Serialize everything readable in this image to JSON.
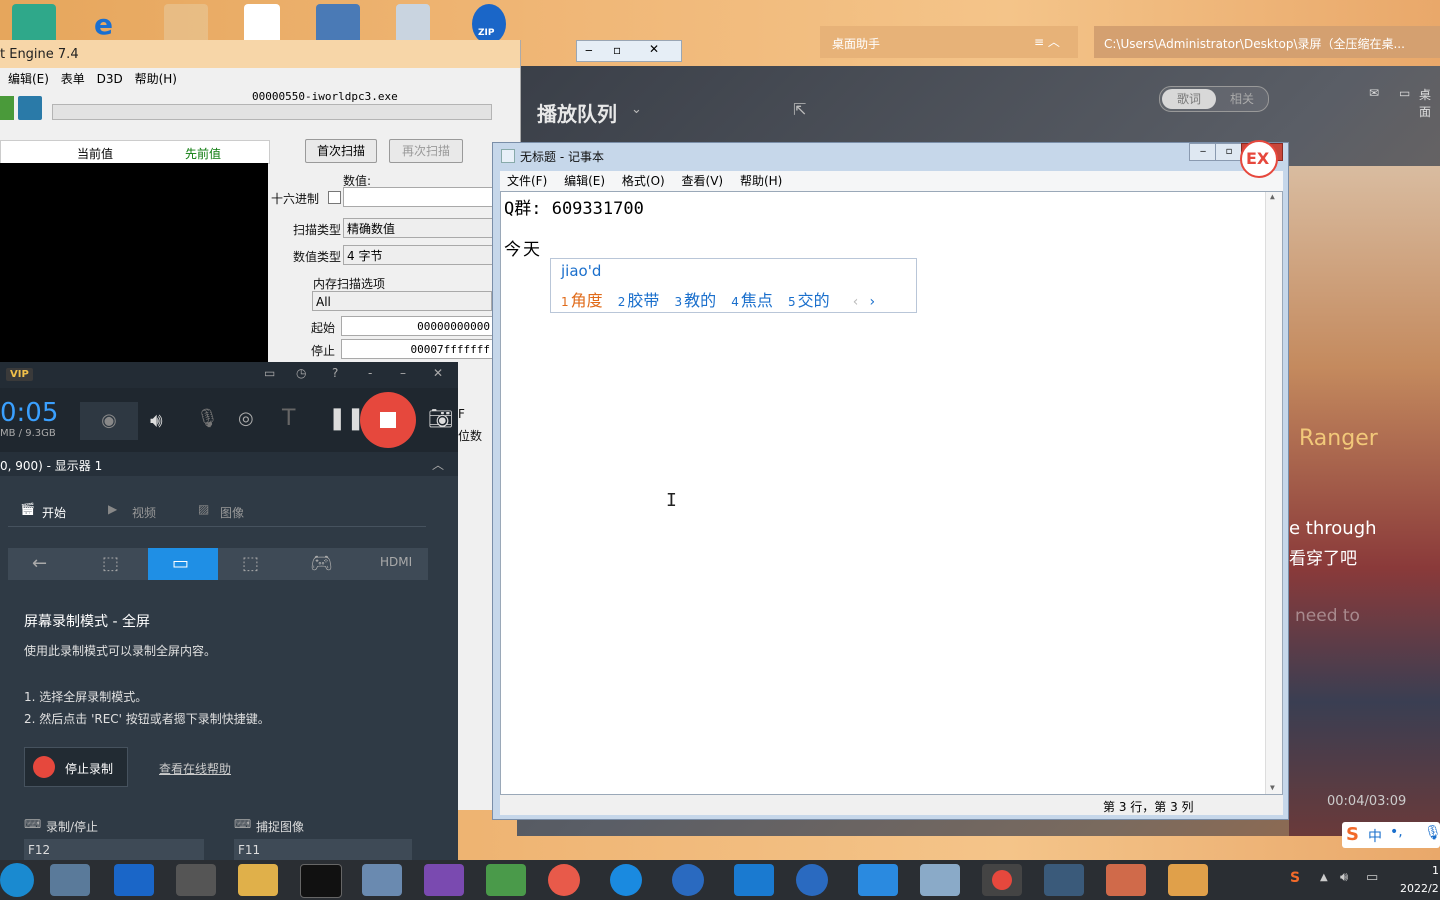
{
  "ce": {
    "title": "t Engine 7.4",
    "process": "00000550-iworldpc3.exe",
    "menu": [
      "编辑(E)",
      "表单",
      "D3D",
      "帮助(H)"
    ],
    "col_current": "当前值",
    "col_previous": "先前值",
    "first_scan": "首次扫描",
    "next_scan": "再次扫描",
    "value_label": "数值:",
    "hex_label": "十六进制",
    "scan_type_label": "扫描类型",
    "scan_type_value": "精确数值",
    "value_type_label": "数值类型",
    "value_type_value": "4 字节",
    "mem_options": "内存扫描选项",
    "mem_all": "All",
    "start_label": "起始",
    "start_value": "00000000000",
    "stop_label": "停止",
    "stop_value": "00007fffffff",
    "frag1": "F",
    "frag2": "位数"
  },
  "music": {
    "queue_title": "播放队列",
    "tab_lyrics": "歌词",
    "tab_related": "相关",
    "desktop_label": "桌面",
    "artist": "Ranger",
    "lyric1": "e through",
    "lyric2": "看穿了吧",
    "lyric3": "need to",
    "time": "00:04/03:09"
  },
  "helper": {
    "title": "桌面助手"
  },
  "explorer": {
    "path": "C:\\Users\\Administrator\\Desktop\\录屏（全压缩在桌..."
  },
  "recorder": {
    "badge": "VIP",
    "timer": "0:05",
    "size": "MB / 9.3GB",
    "display": "0, 900) - 显示器 1",
    "tab_start": "开始",
    "tab_video": "视频",
    "tab_image": "图像",
    "mode_title": "屏幕录制模式 - 全屏",
    "mode_desc": "使用此录制模式可以录制全屏内容。",
    "step1": "1. 选择全屏录制模式。",
    "step2": "2. 然后点击 'REC' 按钮或者摁下录制快捷键。",
    "stop_button": "停止录制",
    "help_link": "查看在线帮助",
    "hotkey_rec_label": "录制/停止",
    "hotkey_rec_value": "F12",
    "hotkey_cap_label": "捕捉图像",
    "hotkey_cap_value": "F11"
  },
  "notepad": {
    "title": "无标题 - 记事本",
    "menu": [
      "文件(F)",
      "编辑(E)",
      "格式(O)",
      "查看(V)",
      "帮助(H)"
    ],
    "line1": "Q群: 609331700",
    "line3": "今天",
    "status": "第 3 行，第 3 列"
  },
  "ime": {
    "input": "jiao'd",
    "candidates": [
      {
        "n": "1",
        "w": "角度"
      },
      {
        "n": "2",
        "w": "胶带"
      },
      {
        "n": "3",
        "w": "教的"
      },
      {
        "n": "4",
        "w": "焦点"
      },
      {
        "n": "5",
        "w": "交的"
      }
    ],
    "brand": "EX"
  },
  "tray": {
    "ime_mode": "中",
    "clock_time": "1",
    "clock_date": "2022/2"
  },
  "colors": {
    "accent_blue": "#1f8fe5",
    "rec_red": "#e6483d",
    "ime_blue": "#1a6fcc",
    "ime_orange": "#e06b1a"
  }
}
